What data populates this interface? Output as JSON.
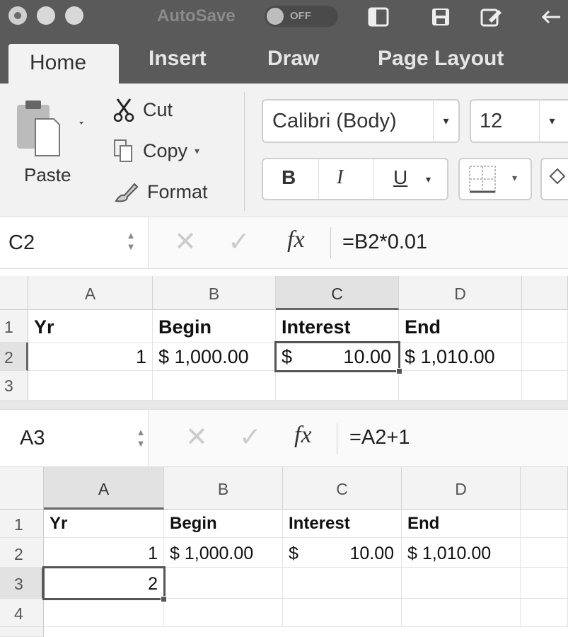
{
  "titlebar": {
    "autosave_label": "AutoSave",
    "toggle_state": "OFF"
  },
  "tabs": [
    "Home",
    "Insert",
    "Draw",
    "Page Layout"
  ],
  "ribbon": {
    "paste_label": "Paste",
    "cut_label": "Cut",
    "copy_label": "Copy",
    "format_label": "Format",
    "font_name": "Calibri (Body)",
    "font_size": "12",
    "bold_label": "B",
    "italic_label": "I",
    "underline_label": "U"
  },
  "top": {
    "name_box": "C2",
    "formula": "=B2*0.01",
    "fx_label": "fx",
    "columns": [
      "A",
      "B",
      "C",
      "D"
    ],
    "rows": [
      "1",
      "2",
      "3"
    ],
    "cells": {
      "A1": "Yr",
      "B1": "Begin",
      "C1": "Interest",
      "D1": "End",
      "A2": "1",
      "B2": "$ 1,000.00",
      "C2_sym": "$",
      "C2_num": "10.00",
      "D2": "$ 1,010.00"
    },
    "selected_cell": "C2"
  },
  "bottom": {
    "name_box": "A3",
    "formula": "=A2+1",
    "fx_label": "fx",
    "columns": [
      "A",
      "B",
      "C",
      "D"
    ],
    "rows": [
      "1",
      "2",
      "3",
      "4"
    ],
    "cells": {
      "A1": "Yr",
      "B1": "Begin",
      "C1": "Interest",
      "D1": "End",
      "A2": "1",
      "B2": "$ 1,000.00",
      "C2_sym": "$",
      "C2_num": "10.00",
      "D2": "$ 1,010.00",
      "A3": "2"
    },
    "selected_cell": "A3"
  }
}
